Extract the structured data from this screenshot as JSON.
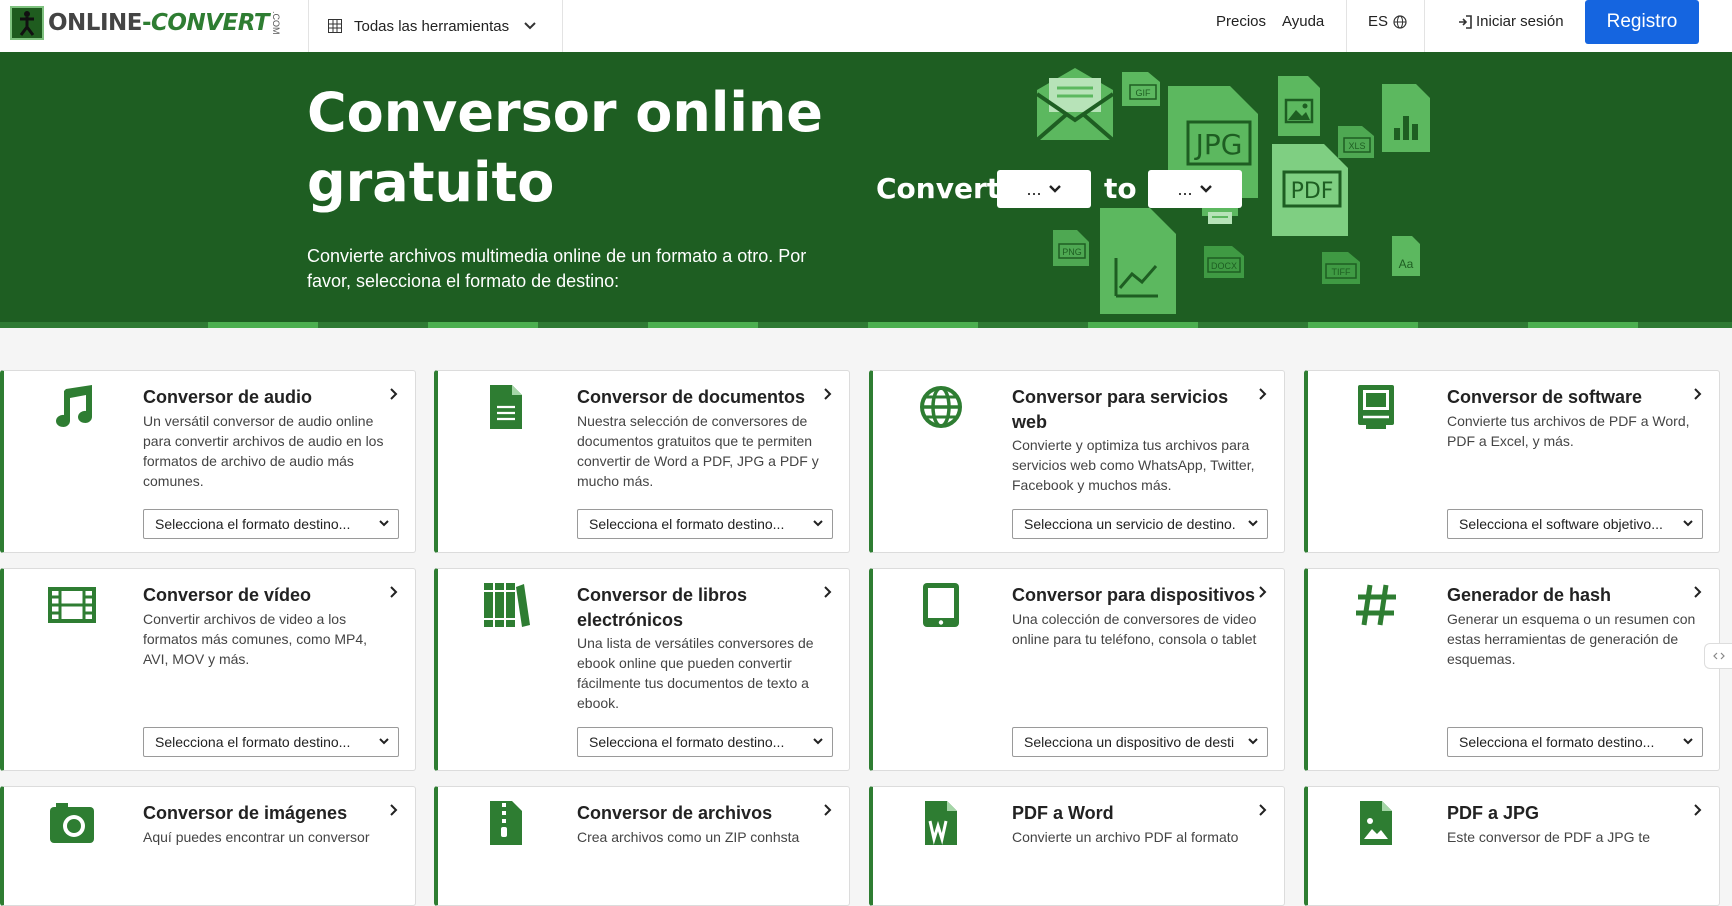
{
  "header": {
    "logo_text_a": "ONLINE",
    "logo_text_b": "-",
    "logo_text_c": "CONVERT",
    "logo_com": ".COM",
    "tools_label": "Todas las herramientas",
    "pricing": "Precios",
    "help": "Ayuda",
    "language": "ES",
    "login": "Iniciar sesión",
    "register": "Registro"
  },
  "hero": {
    "title": "Conversor online gratuito",
    "subtitle": "Convierte archivos multimedia online de un formato a otro. Por favor, selecciona el formato de destino:",
    "convert_label": "Convert",
    "to_label": "to",
    "from_value": "...",
    "to_value": "...",
    "deco_labels": [
      "GIF",
      "JPG",
      "XLS",
      "PDF",
      "PNG",
      "DOCX",
      "TIFF",
      "Aa"
    ]
  },
  "cards": [
    {
      "title": "Conversor de audio",
      "icon": "music-note-icon",
      "description": "Un versátil conversor de audio online para convertir archivos de audio en los formatos de archivo de audio más comunes.",
      "select": "Selecciona el formato destino..."
    },
    {
      "title": "Conversor de documentos",
      "icon": "document-icon",
      "description": "Nuestra selección de conversores de documentos gratuitos que te permiten convertir de Word a PDF, JPG a PDF y mucho más.",
      "select": "Selecciona el formato destino..."
    },
    {
      "title": "Conversor para servicios web",
      "icon": "globe-icon",
      "description": "Convierte y optimiza tus archivos para servicios web como WhatsApp, Twitter, Facebook y muchos más.",
      "select": "Selecciona un servicio de destino."
    },
    {
      "title": "Conversor de software",
      "icon": "computer-icon",
      "description": "Convierte tus archivos de PDF a Word, PDF a Excel, y más.",
      "select": "Selecciona el software objetivo..."
    },
    {
      "title": "Conversor de vídeo",
      "icon": "film-icon",
      "description": "Convertir archivos de video a los formatos más comunes, como MP4, AVI, MOV y más.",
      "select": "Selecciona el formato destino..."
    },
    {
      "title": "Conversor de libros electrónicos",
      "icon": "books-icon",
      "description": "Una lista de versátiles conversores de ebook online que pueden convertir fácilmente tus documentos de texto a ebook.",
      "select": "Selecciona el formato destino..."
    },
    {
      "title": "Conversor para dispositivos",
      "icon": "tablet-icon",
      "description": "Una colección de conversores de video online para tu teléfono, consola o tablet",
      "select": "Selecciona un dispositivo de desti"
    },
    {
      "title": "Generador de hash",
      "icon": "hash-icon",
      "description": "Generar un esquema o un resumen con estas herramientas de generación de esquemas.",
      "select": "Selecciona el formato destino..."
    },
    {
      "title": "Conversor de imágenes",
      "icon": "camera-icon",
      "description": "Aquí puedes encontrar un conversor"
    },
    {
      "title": "Conversor de archivos",
      "icon": "zip-file-icon",
      "description": "Crea archivos como un ZIP conhsta"
    },
    {
      "title": "PDF a Word",
      "icon": "word-file-icon",
      "description": "Convierte un archivo PDF al formato"
    },
    {
      "title": "PDF a JPG",
      "icon": "image-file-icon",
      "description": "Este conversor de PDF a JPG te"
    }
  ],
  "colors": {
    "brand_green": "#2e7d32",
    "hero_green": "#1e5e22",
    "register_blue": "#1565e0"
  }
}
